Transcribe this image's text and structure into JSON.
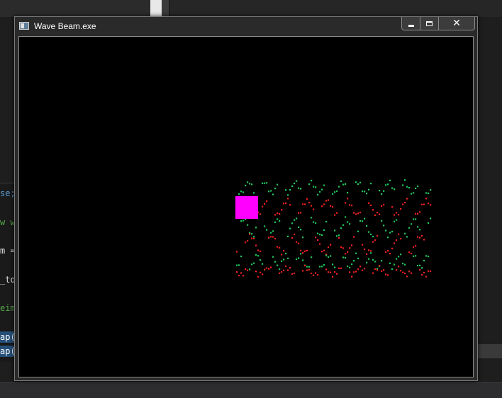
{
  "window": {
    "title": "Wave Beam.exe",
    "close_glyph": "✕"
  },
  "ide": {
    "code_lines": [
      {
        "text": "se;",
        "color": "#569cd6",
        "selected": false
      },
      {
        "text": "w w",
        "color": "#57a64a",
        "selected": false
      },
      {
        "text": "m =",
        "color": "#dcdcdc",
        "selected": false
      },
      {
        "text": "_to",
        "color": "#dcdcdc",
        "selected": false
      },
      {
        "text": "eim",
        "color": "#57a64a",
        "selected": false
      },
      {
        "text": "ap(",
        "color": "#ffffff",
        "selected": true
      },
      {
        "text": "ap(",
        "color": "#ffffff",
        "selected": true
      }
    ]
  },
  "game": {
    "background": "#000000",
    "player": {
      "label": "player-block",
      "color": "#ff00ff"
    },
    "beam": {
      "colors": [
        "#22c55e",
        "#ef2020"
      ]
    }
  },
  "icons": [
    "app-icon",
    "minimize-icon",
    "maximize-icon",
    "close-icon"
  ]
}
